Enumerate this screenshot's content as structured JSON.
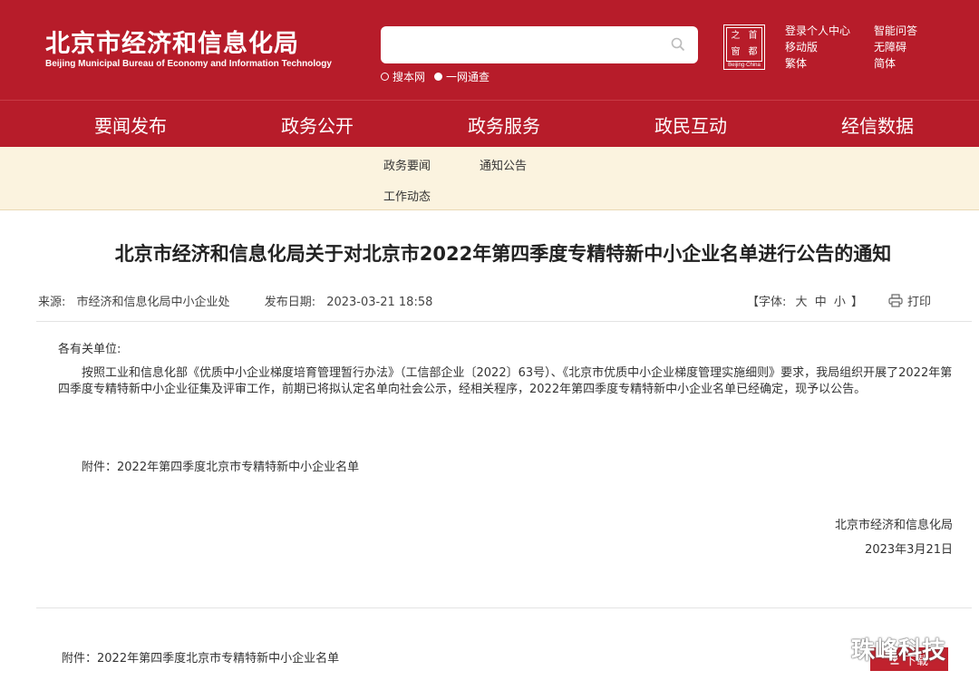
{
  "header": {
    "logo_cn": "北京市经济和信息化局",
    "logo_en": "Beijing Municipal Bureau of Economy and Information Technology",
    "search": {
      "placeholder": "",
      "options": [
        "搜本网",
        "一网通查"
      ]
    },
    "seal": {
      "chars": [
        "首",
        "之",
        "都",
        "窗"
      ],
      "caption": "Beijing·China"
    },
    "links": [
      "登录个人中心",
      "智能问答",
      "移动版",
      "无障碍",
      "繁体",
      "简体"
    ]
  },
  "nav": {
    "items": [
      "要闻发布",
      "政务公开",
      "政务服务",
      "政民互动",
      "经信数据"
    ],
    "active": "要闻发布"
  },
  "subnav": {
    "items": [
      "政务要闻",
      "通知公告",
      "工作动态"
    ]
  },
  "article": {
    "title": "北京市经济和信息化局关于对北京市2022年第四季度专精特新中小企业名单进行公告的通知",
    "source_label": "来源:",
    "source": "市经济和信息化局中小企业处",
    "date_label": "发布日期:",
    "date": "2023-03-21 18:58",
    "font_label_open": "【字体:",
    "font_sizes": [
      "大",
      "中",
      "小"
    ],
    "font_label_close": "】",
    "print": "打印",
    "salutation": "各有关单位:",
    "paragraph": "按照工业和信息化部《优质中小企业梯度培育管理暂行办法》（工信部企业〔2022〕63号）、《北京市优质中小企业梯度管理实施细则》要求，我局组织开展了2022年第四季度专精特新中小企业征集及评审工作，前期已将拟认定名单向社会公示，经相关程序，2022年第四季度专精特新中小企业名单已经确定，现予以公告。",
    "attachment": "附件：2022年第四季度北京市专精特新中小企业名单",
    "sign_org": "北京市经济和信息化局",
    "sign_date": "2023年3月21日"
  },
  "attachments": {
    "item": "附件：2022年第四季度北京市专精特新中小企业名单",
    "download": "下载"
  },
  "watermark": {
    "text": "珠峰科技"
  },
  "colors": {
    "brand_red": "#b71c2a",
    "subnav_bg": "#fbf3df"
  }
}
